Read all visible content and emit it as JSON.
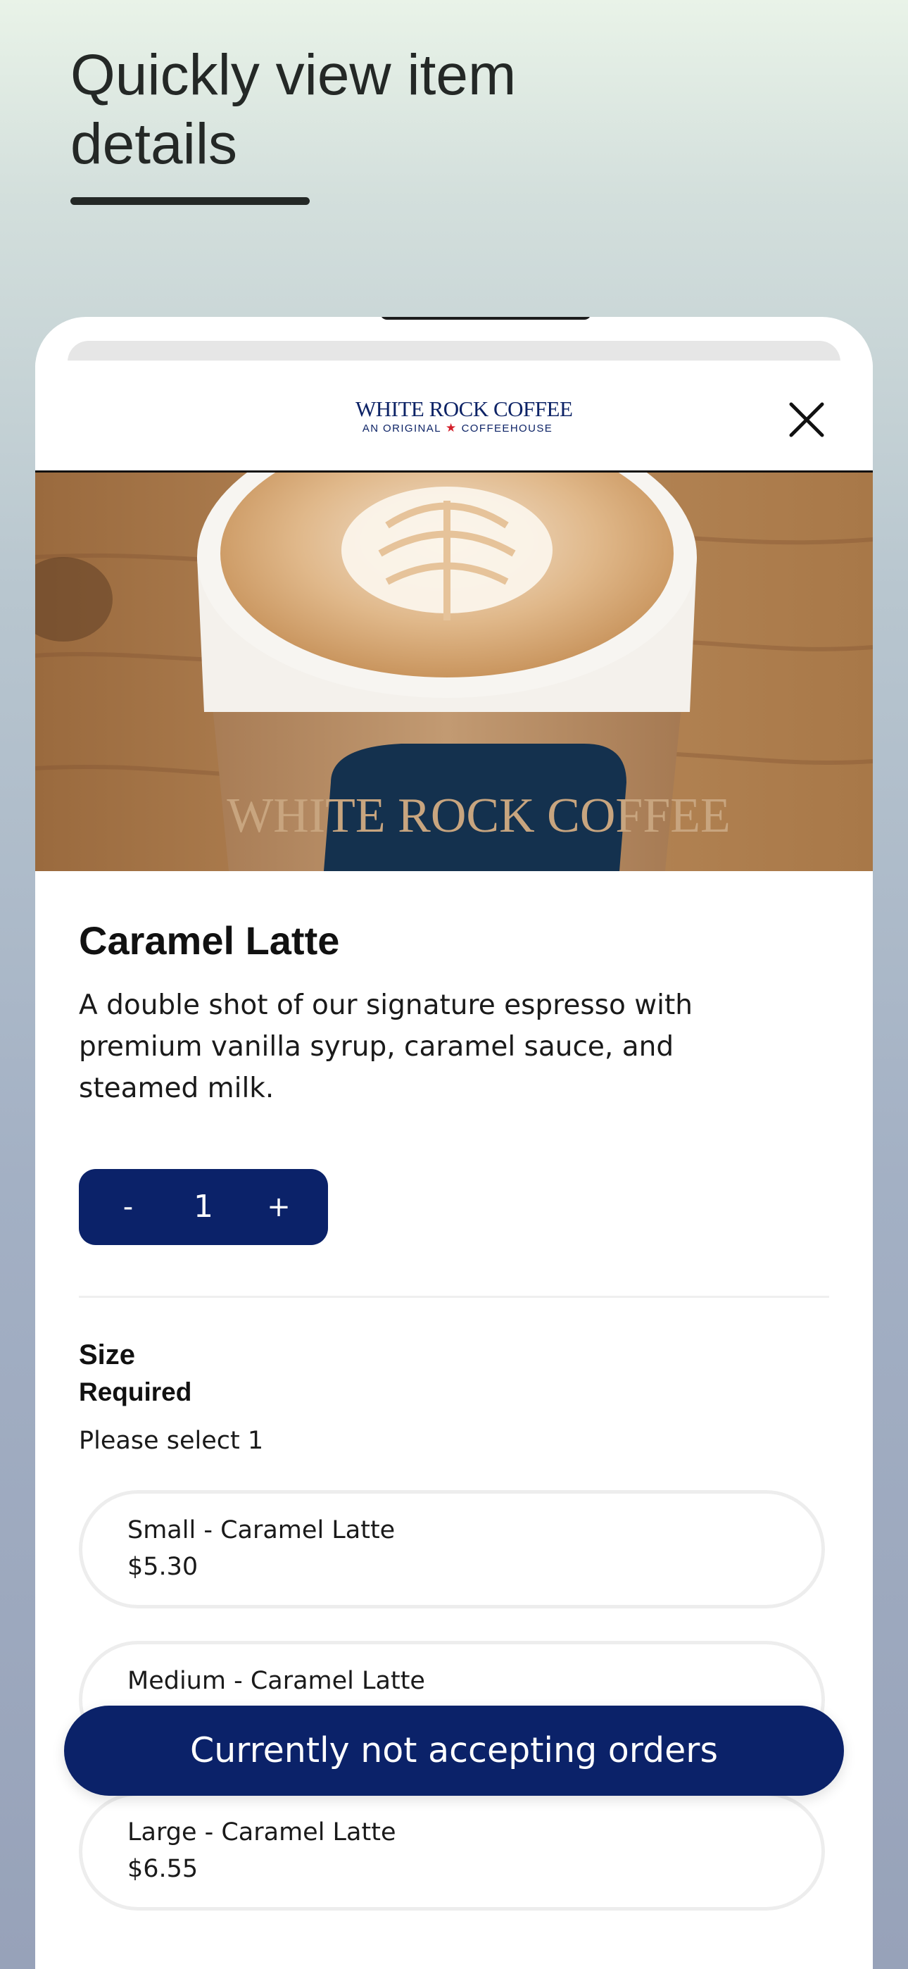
{
  "page_heading": "Quickly view item details",
  "header": {
    "logo_main": "WHITE ROCK COFFEE",
    "logo_sub_left": "AN ORIGINAL",
    "logo_sub_right": "COFFEEHOUSE"
  },
  "hero_image": {
    "cup_print": "WHITE ROCK COFFEE"
  },
  "item": {
    "title": "Caramel Latte",
    "description": "A double shot of our signature espresso with premium vanilla syrup, caramel sauce, and steamed milk."
  },
  "stepper": {
    "minus_label": "-",
    "quantity": "1",
    "plus_label": "+"
  },
  "size_group": {
    "label": "Size",
    "required": "Required",
    "hint": "Please select 1",
    "options": [
      {
        "name": "Small - Caramel Latte",
        "price": "$5.30"
      },
      {
        "name": "Medium - Caramel Latte",
        "price": ""
      },
      {
        "name": "Large - Caramel Latte",
        "price": "$6.55"
      }
    ]
  },
  "cta": {
    "label": "Currently not accepting orders"
  },
  "colors": {
    "brand_navy": "#0b2269",
    "logo_star_red": "#d4202b"
  },
  "icons": [
    "close-icon",
    "texas-star-icon"
  ]
}
